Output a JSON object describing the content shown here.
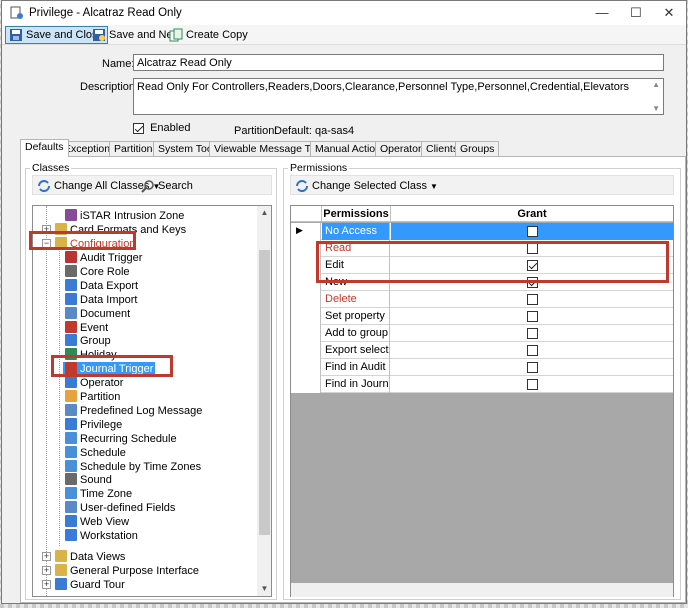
{
  "window": {
    "title": "Privilege  -  Alcatraz Read Only",
    "controls": {
      "minimize": "—",
      "maximize": "☐",
      "close": "✕"
    }
  },
  "toolbar": {
    "save_close": "Save and Close",
    "save_new": "Save and New",
    "create_copy": "Create Copy"
  },
  "form": {
    "name_label": "Name:",
    "name_value": "Alcatraz Read Only",
    "description_label": "Description:",
    "description_value": "Read Only For Controllers,Readers,Doors,Clearance,Personnel Type,Personnel,Credential,Elevators",
    "enabled_label": "Enabled",
    "enabled_checked": true,
    "partition_label": "Partition:",
    "partition_value": "Default: qa-sas4"
  },
  "tabs": [
    "Defaults",
    "Exceptions",
    "Partitions",
    "System Tools",
    "Viewable Message Types",
    "Manual Actions",
    "Operators",
    "Clients",
    "Groups"
  ],
  "classes": {
    "title": "Classes",
    "change_all": "Change All Classes",
    "search": "Search",
    "tree": [
      {
        "label": "iSTAR Intrusion Zone",
        "icon": "istar-icon",
        "color": "#8a4a9a"
      },
      {
        "label": "Card Formats and Keys",
        "icon": "folder-icon",
        "color": "#d9b24a"
      },
      {
        "label": "Configuration",
        "icon": "folder-open-icon",
        "color": "#d9b24a"
      },
      {
        "label": "Audit Trigger",
        "icon": "audit-trigger-icon",
        "color": "#b33"
      },
      {
        "label": "Core Role",
        "icon": "core-role-icon",
        "color": "#6a6a6a"
      },
      {
        "label": "Data Export",
        "icon": "data-export-icon",
        "color": "#3a7bd5"
      },
      {
        "label": "Data Import",
        "icon": "data-import-icon",
        "color": "#3a7bd5"
      },
      {
        "label": "Document",
        "icon": "document-icon",
        "color": "#5a8ac6"
      },
      {
        "label": "Event",
        "icon": "event-icon",
        "color": "#c0392b"
      },
      {
        "label": "Group",
        "icon": "group-icon",
        "color": "#3a7bd5"
      },
      {
        "label": "Holiday",
        "icon": "holiday-icon",
        "color": "#2e8b57"
      },
      {
        "label": "Journal Trigger",
        "icon": "journal-trigger-icon",
        "color": "#c0392b"
      },
      {
        "label": "Operator",
        "icon": "operator-icon",
        "color": "#3a7bd5"
      },
      {
        "label": "Partition",
        "icon": "partition-icon",
        "color": "#e6a23c"
      },
      {
        "label": "Predefined Log Message",
        "icon": "log-message-icon",
        "color": "#5a8ac6"
      },
      {
        "label": "Privilege",
        "icon": "privilege-icon",
        "color": "#3a7bd5"
      },
      {
        "label": "Recurring Schedule",
        "icon": "recurring-schedule-icon",
        "color": "#4a90d9"
      },
      {
        "label": "Schedule",
        "icon": "schedule-icon",
        "color": "#4a90d9"
      },
      {
        "label": "Schedule by Time Zones",
        "icon": "schedule-tz-icon",
        "color": "#4a90d9"
      },
      {
        "label": "Sound",
        "icon": "sound-icon",
        "color": "#6a6a6a"
      },
      {
        "label": "Time Zone",
        "icon": "time-zone-icon",
        "color": "#4a90d9"
      },
      {
        "label": "User-defined Fields",
        "icon": "user-fields-icon",
        "color": "#5a8ac6"
      },
      {
        "label": "Web View",
        "icon": "web-view-icon",
        "color": "#3a7bd5"
      },
      {
        "label": "Workstation",
        "icon": "workstation-icon",
        "color": "#3a7bd5"
      },
      {
        "label": "Data Views",
        "icon": "folder-icon",
        "color": "#d9b24a"
      },
      {
        "label": "General Purpose Interface",
        "icon": "gpi-icon",
        "color": "#d9b24a"
      },
      {
        "label": "Guard Tour",
        "icon": "guard-tour-icon",
        "color": "#3a7bd5"
      }
    ]
  },
  "permissions": {
    "title": "Permissions",
    "change_selected": "Change Selected Class",
    "col_permissions": "Permissions",
    "col_grant": "Grant",
    "rows": [
      {
        "label": "No Access",
        "checked": false,
        "selected": true
      },
      {
        "label": "Read",
        "checked": false,
        "selected": false
      },
      {
        "label": "Edit",
        "checked": true,
        "selected": false
      },
      {
        "label": "New",
        "checked": true,
        "selected": false
      },
      {
        "label": "Delete",
        "checked": false,
        "selected": false
      },
      {
        "label": "Set property",
        "checked": false,
        "selected": false
      },
      {
        "label": "Add to group",
        "checked": false,
        "selected": false
      },
      {
        "label": "Export selection",
        "checked": false,
        "selected": false
      },
      {
        "label": "Find in Audit Log",
        "checked": false,
        "selected": false
      },
      {
        "label": "Find in Journal",
        "checked": false,
        "selected": false
      }
    ]
  }
}
